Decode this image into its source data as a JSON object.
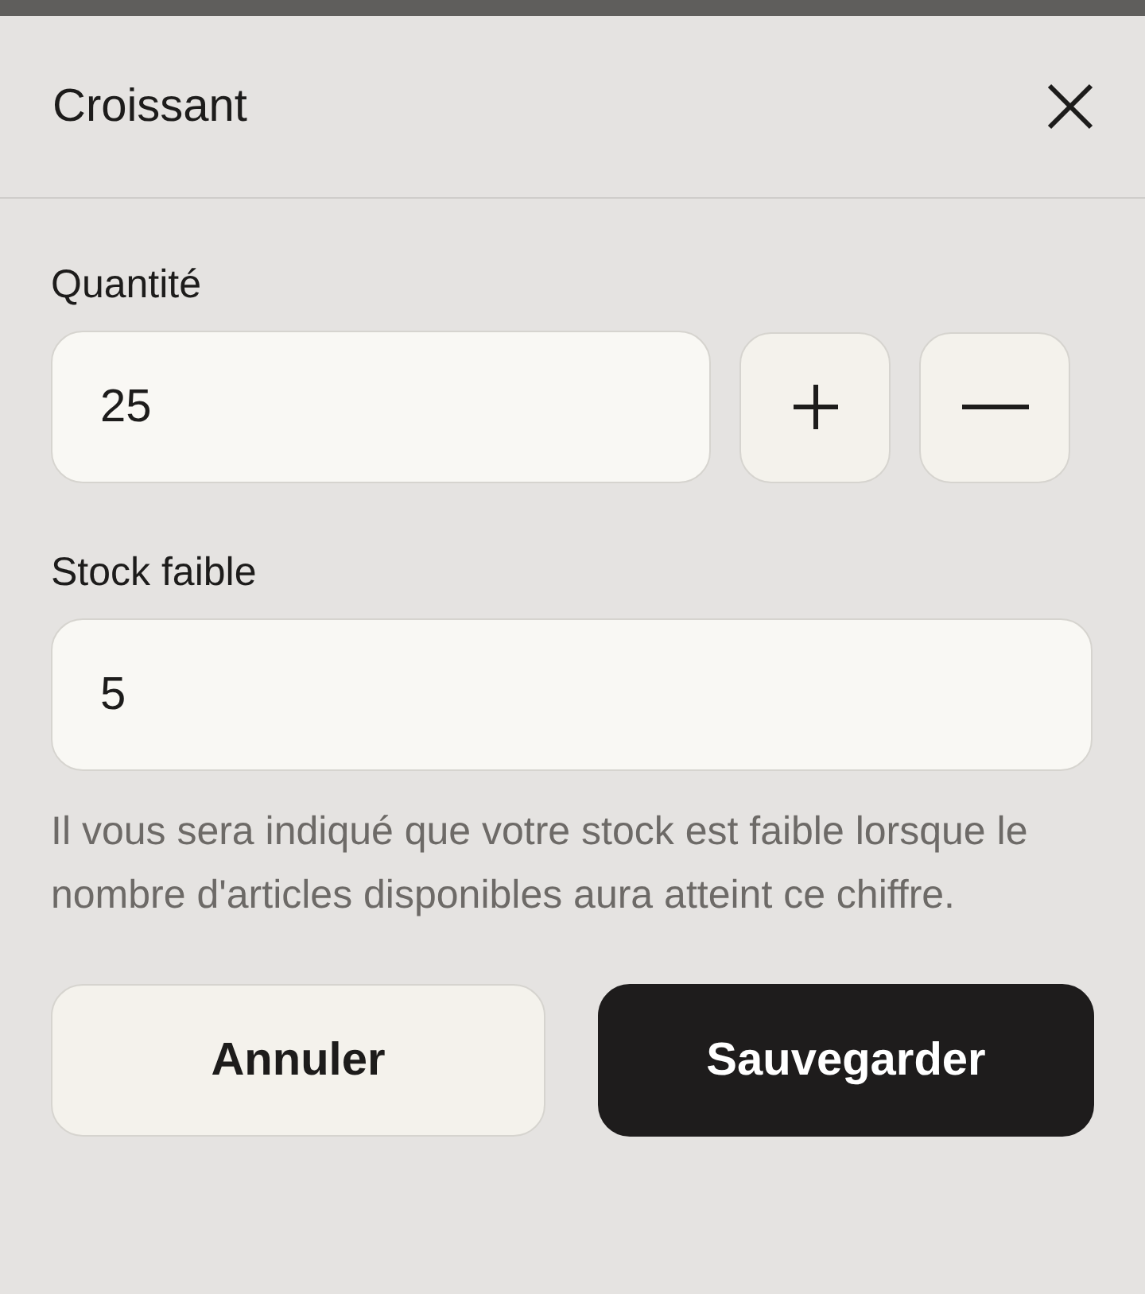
{
  "dialog": {
    "title": "Croissant"
  },
  "quantity": {
    "label": "Quantité",
    "value": "25"
  },
  "low_stock": {
    "label": "Stock faible",
    "value": "5",
    "help": "Il vous sera indiqué que votre stock est faible lorsque le nombre d'articles disponibles aura atteint ce chiffre."
  },
  "buttons": [
    {
      "label": "Annuler",
      "kind": "secondary"
    },
    {
      "label": "Sauvegarder",
      "kind": "primary"
    }
  ]
}
